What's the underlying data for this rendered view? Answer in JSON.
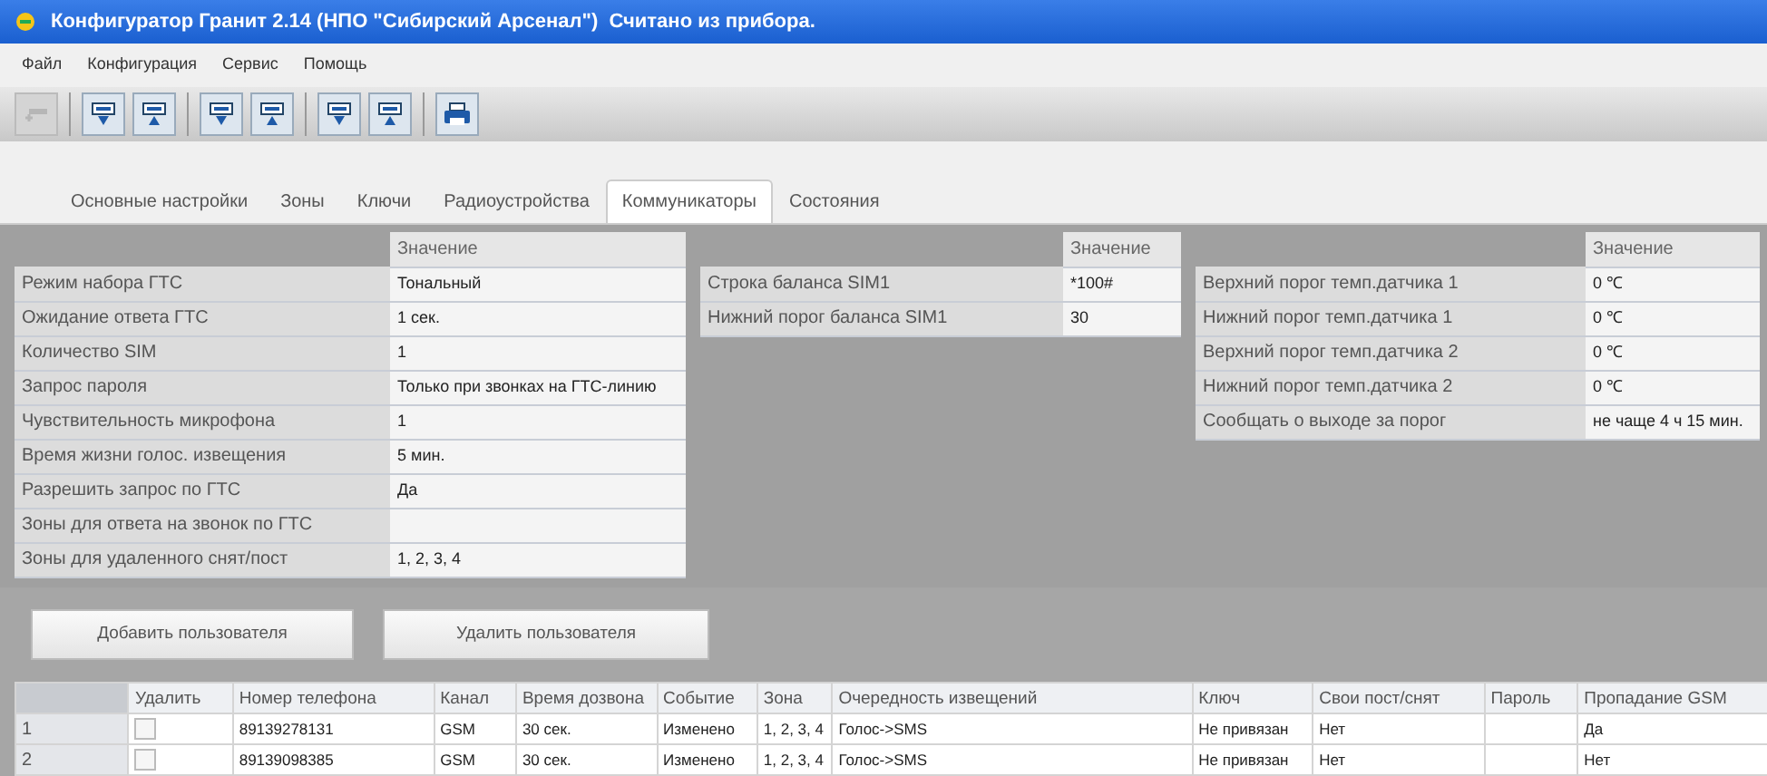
{
  "window": {
    "title": "Конфигуратор Гранит 2.14 (НПО \"Сибирский Арсенал\")  Считано из прибора."
  },
  "menu": [
    "Файл",
    "Конфигурация",
    "Сервис",
    "Помощь"
  ],
  "toolbar": [
    {
      "kind": "add",
      "disabled": true
    },
    {
      "kind": "down",
      "disabled": false
    },
    {
      "kind": "up",
      "disabled": false
    },
    {
      "kind": "down",
      "disabled": false
    },
    {
      "kind": "up",
      "disabled": false
    },
    {
      "kind": "down",
      "disabled": false
    },
    {
      "kind": "up",
      "disabled": false
    },
    {
      "kind": "print",
      "disabled": false
    }
  ],
  "tabs": [
    {
      "label": "Основные настройки",
      "selected": false
    },
    {
      "label": "Зоны",
      "selected": false
    },
    {
      "label": "Ключи",
      "selected": false
    },
    {
      "label": "Радиоустройства",
      "selected": false
    },
    {
      "label": "Коммуникаторы",
      "selected": true
    },
    {
      "label": "Состояния",
      "selected": false
    }
  ],
  "grids": [
    {
      "value_header": "Значение",
      "rows": [
        [
          "Режим набора ГТС",
          "Тональный"
        ],
        [
          "Ожидание ответа ГТС",
          "1 сек."
        ],
        [
          "Количество SIM",
          "1"
        ],
        [
          "Запрос пароля",
          "Только при звонках на ГТС-линию"
        ],
        [
          "Чувствительность микрофона",
          "1"
        ],
        [
          "Время жизни голос. извещения",
          "5 мин."
        ],
        [
          "Разрешить запрос по ГТС",
          "Да"
        ],
        [
          "Зоны для ответа на звонок по ГТС",
          ""
        ],
        [
          "Зоны для удаленного снят/пост",
          "1, 2, 3, 4"
        ]
      ]
    },
    {
      "value_header": "Значение",
      "rows": [
        [
          "Строка баланса SIM1",
          "*100#"
        ],
        [
          "Нижний порог баланса SIM1",
          "30"
        ]
      ]
    },
    {
      "value_header": "Значение",
      "rows": [
        [
          "Верхний порог темп.датчика 1",
          "0 ℃"
        ],
        [
          "Нижний порог темп.датчика 1",
          "0 ℃"
        ],
        [
          "Верхний порог темп.датчика 2",
          "0 ℃"
        ],
        [
          "Нижний порог темп.датчика 2",
          "0 ℃"
        ],
        [
          "Сообщать о выходе за порог",
          "не чаще 4 ч 15 мин."
        ]
      ]
    }
  ],
  "buttons": [
    "Добавить пользователя",
    "Удалить пользователя"
  ],
  "users": {
    "columns": [
      "",
      "Удалить",
      "Номер телефона",
      "Канал",
      "Время дозвона",
      "Событие",
      "Зона",
      "Очередность извещений",
      "Ключ",
      "Свои пост/снят",
      "Пароль",
      "Пропадание GSM"
    ],
    "rows": [
      {
        "cells": [
          "1",
          {
            "checked": false
          },
          "89139278131",
          "GSM",
          "30 сек.",
          "Изменено",
          "1, 2, 3, 4",
          "Голос->SMS",
          "Не привязан",
          "Нет",
          "",
          "Да"
        ]
      },
      {
        "cells": [
          "2",
          {
            "checked": false
          },
          "89139098385",
          "GSM",
          "30 сек.",
          "Изменено",
          "1, 2, 3, 4",
          "Голос->SMS",
          "Не привязан",
          "Нет",
          "",
          "Нет"
        ]
      }
    ]
  }
}
